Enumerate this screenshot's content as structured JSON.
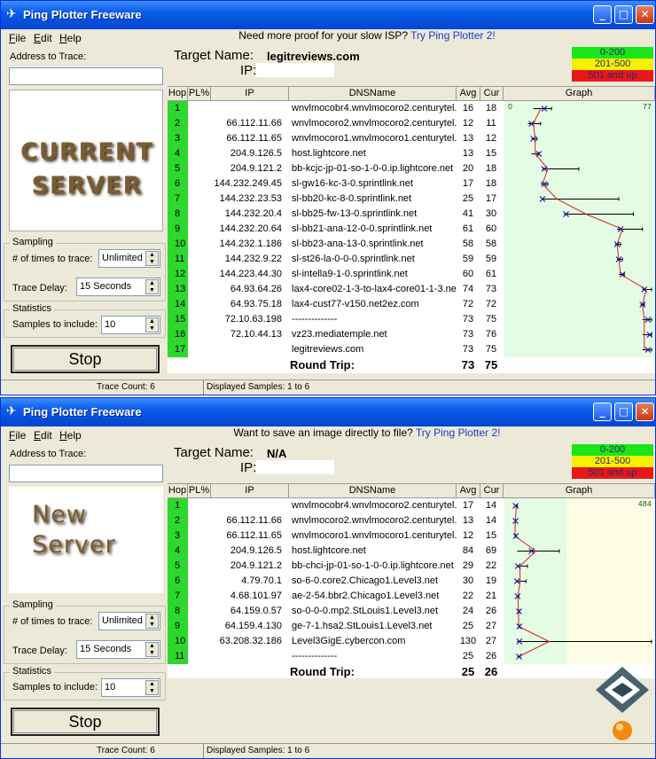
{
  "windows": [
    {
      "title": "Ping Plotter Freeware",
      "menu": [
        "File",
        "Edit",
        "Help"
      ],
      "address_label": "Address to Trace:",
      "address_value": "",
      "preview_lines": [
        "CURRENT",
        "SERVER"
      ],
      "sampling_title": "Sampling",
      "times_label": "# of times to trace:",
      "times_value": "Unlimited",
      "delay_label": "Trace Delay:",
      "delay_value": "15 Seconds",
      "stats_title": "Statistics",
      "samples_label": "Samples to include:",
      "samples_value": "10",
      "stop_label": "Stop",
      "message": "Need more proof for your slow ISP?",
      "message_link": "Try Ping Plotter 2!",
      "target_name_label": "Target Name:",
      "target_name_value": "legitreviews.com",
      "ip_label": "IP:",
      "legend": [
        {
          "label": "0-200",
          "color": "#19e619"
        },
        {
          "label": "201-500",
          "color": "#f7f000"
        },
        {
          "label": "501 and up",
          "color": "#e81818"
        }
      ],
      "columns": [
        "Hop",
        "PL%",
        "IP",
        "DNSName",
        "Avg",
        "Cur",
        "Graph"
      ],
      "graph_axis": {
        "min_label": "0",
        "max_label": "77",
        "max": 77
      },
      "hops": [
        {
          "hop": "1",
          "ip": "",
          "dns": "wnvlmocobr4.wnvlmocoro2.centurytel.r",
          "avg": "16",
          "cur": "18",
          "err": [
            12,
            22
          ]
        },
        {
          "hop": "2",
          "ip": "66.112.11.66",
          "dns": "wnvlmocoro2.wnvlmocoro2.centurytel.r",
          "avg": "12",
          "cur": "11",
          "err": [
            9,
            16
          ]
        },
        {
          "hop": "3",
          "ip": "66.112.11.65",
          "dns": "wnvlmocoro1.wnvlmocoro1.centurytel.r",
          "avg": "13",
          "cur": "12",
          "err": [
            11,
            14
          ]
        },
        {
          "hop": "4",
          "ip": "204.9.126.5",
          "dns": "host.lightcore.net",
          "avg": "13",
          "cur": "15",
          "err": [
            11,
            15
          ]
        },
        {
          "hop": "5",
          "ip": "204.9.121.2",
          "dns": "bb-kcjc-jp-01-so-1-0-0.ip.lightcore.net",
          "avg": "20",
          "cur": "18",
          "err": [
            17,
            37
          ]
        },
        {
          "hop": "6",
          "ip": "144.232.249.45",
          "dns": "sl-gw16-kc-3-0.sprintlink.net",
          "avg": "17",
          "cur": "18",
          "err": [
            16,
            20
          ]
        },
        {
          "hop": "7",
          "ip": "144.232.23.53",
          "dns": "sl-bb20-kc-8-0.sprintlink.net",
          "avg": "25",
          "cur": "17",
          "err": [
            17,
            59
          ]
        },
        {
          "hop": "8",
          "ip": "144.232.20.4",
          "dns": "sl-bb25-fw-13-0.sprintlink.net",
          "avg": "41",
          "cur": "30",
          "err": [
            29,
            67
          ]
        },
        {
          "hop": "9",
          "ip": "144.232.20.64",
          "dns": "sl-bb21-ana-12-0-0.sprintlink.net",
          "avg": "61",
          "cur": "60",
          "err": [
            58,
            72
          ]
        },
        {
          "hop": "10",
          "ip": "144.232.1.186",
          "dns": "sl-bb23-ana-13-0.sprintlink.net",
          "avg": "58",
          "cur": "58",
          "err": [
            57,
            60
          ]
        },
        {
          "hop": "11",
          "ip": "144.232.9.22",
          "dns": "sl-st26-la-0-0-0.sprintlink.net",
          "avg": "59",
          "cur": "59",
          "err": [
            58,
            61
          ]
        },
        {
          "hop": "12",
          "ip": "144.223.44.30",
          "dns": "sl-intella9-1-0.sprintlink.net",
          "avg": "60",
          "cur": "61",
          "err": [
            59,
            62
          ]
        },
        {
          "hop": "13",
          "ip": "64.93.64.26",
          "dns": "lax4-core02-1-3-to-lax4-core01-1-3.net2",
          "avg": "74",
          "cur": "73",
          "err": [
            72,
            77
          ]
        },
        {
          "hop": "14",
          "ip": "64.93.75.18",
          "dns": "lax4-cust77-v150.net2ez.com",
          "avg": "72",
          "cur": "72",
          "err": [
            71,
            73
          ]
        },
        {
          "hop": "15",
          "ip": "72.10.63.198",
          "dns": "--------------",
          "avg": "73",
          "cur": "75",
          "err": [
            72,
            77
          ]
        },
        {
          "hop": "16",
          "ip": "72.10.44.13",
          "dns": "vz23.mediatemple.net",
          "avg": "73",
          "cur": "76",
          "err": [
            72,
            77
          ]
        },
        {
          "hop": "17",
          "ip": "",
          "dns": "legitreviews.com",
          "avg": "73",
          "cur": "75",
          "err": [
            72,
            77
          ]
        }
      ],
      "round_trip_label": "Round Trip:",
      "round_trip_avg": "73",
      "round_trip_cur": "75",
      "trace_count": "Trace Count: 6",
      "displayed_samples": "Displayed Samples: 1 to 6"
    },
    {
      "title": "Ping Plotter Freeware",
      "menu": [
        "File",
        "Edit",
        "Help"
      ],
      "address_label": "Address to Trace:",
      "address_value": "",
      "preview_lines": [
        "New",
        "Server"
      ],
      "sampling_title": "Sampling",
      "times_label": "# of times to trace:",
      "times_value": "Unlimited",
      "delay_label": "Trace Delay:",
      "delay_value": "15 Seconds",
      "stats_title": "Statistics",
      "samples_label": "Samples to include:",
      "samples_value": "10",
      "stop_label": "Stop",
      "message": "Want to save an image directly to file?",
      "message_link": "Try Ping Plotter 2!",
      "target_name_label": "Target Name:",
      "target_name_value": "N/A",
      "ip_label": "IP:",
      "legend": [
        {
          "label": "0-200",
          "color": "#19e619"
        },
        {
          "label": "201-500",
          "color": "#f7f000"
        },
        {
          "label": "501 and up",
          "color": "#e81818"
        }
      ],
      "columns": [
        "Hop",
        "PL%",
        "IP",
        "DNSName",
        "Avg",
        "Cur",
        "Graph"
      ],
      "graph_axis": {
        "min_label": "",
        "max_label": "484",
        "max": 484
      },
      "hops": [
        {
          "hop": "1",
          "ip": "",
          "dns": "wnvlmocobr4.wnvlmocoro2.centurytel.ne",
          "avg": "17",
          "cur": "14",
          "err": [
            14,
            20
          ]
        },
        {
          "hop": "2",
          "ip": "66.112.11.66",
          "dns": "wnvlmocoro2.wnvlmocoro2.centurytel.ne",
          "avg": "13",
          "cur": "14",
          "err": [
            11,
            14
          ]
        },
        {
          "hop": "3",
          "ip": "66.112.11.65",
          "dns": "wnvlmocoro1.wnvlmocoro1.centurytel.ne",
          "avg": "12",
          "cur": "15",
          "err": [
            11,
            15
          ]
        },
        {
          "hop": "4",
          "ip": "204.9.126.5",
          "dns": "host.lightcore.net",
          "avg": "84",
          "cur": "69",
          "err": [
            20,
            165
          ]
        },
        {
          "hop": "5",
          "ip": "204.9.121.2",
          "dns": "bb-chci-jp-01-so-1-0-0.ip.lightcore.net",
          "avg": "29",
          "cur": "22",
          "err": [
            20,
            55
          ]
        },
        {
          "hop": "6",
          "ip": "4.79.70.1",
          "dns": "so-6-0.core2.Chicago1.Level3.net",
          "avg": "30",
          "cur": "19",
          "err": [
            19,
            50
          ]
        },
        {
          "hop": "7",
          "ip": "4.68.101.97",
          "dns": "ae-2-54.bbr2.Chicago1.Level3.net",
          "avg": "22",
          "cur": "21",
          "err": [
            20,
            25
          ]
        },
        {
          "hop": "8",
          "ip": "64.159.0.57",
          "dns": "so-0-0-0.mp2.StLouis1.Level3.net",
          "avg": "24",
          "cur": "26",
          "err": [
            22,
            27
          ]
        },
        {
          "hop": "9",
          "ip": "64.159.4.130",
          "dns": "ge-7-1.hsa2.StLouis1.Level3.net",
          "avg": "25",
          "cur": "27",
          "err": [
            24,
            28
          ]
        },
        {
          "hop": "10",
          "ip": "63.208.32.186",
          "dns": "Level3GigE.cybercon.com",
          "avg": "130",
          "cur": "27",
          "err": [
            20,
            484
          ]
        },
        {
          "hop": "11",
          "ip": "",
          "dns": "--------------",
          "avg": "25",
          "cur": "26",
          "err": [
            20,
            30
          ]
        }
      ],
      "round_trip_label": "Round Trip:",
      "round_trip_avg": "25",
      "round_trip_cur": "26",
      "trace_count": "Trace Count: 6",
      "displayed_samples": "Displayed Samples: 1 to 6"
    }
  ],
  "colors": {
    "hop_green": "#2dd82d",
    "graph_green_zone": "#e4fbe4",
    "graph_yellow_zone": "#fdfde6",
    "line": "#e02020",
    "marker": "#1a1aa0"
  }
}
